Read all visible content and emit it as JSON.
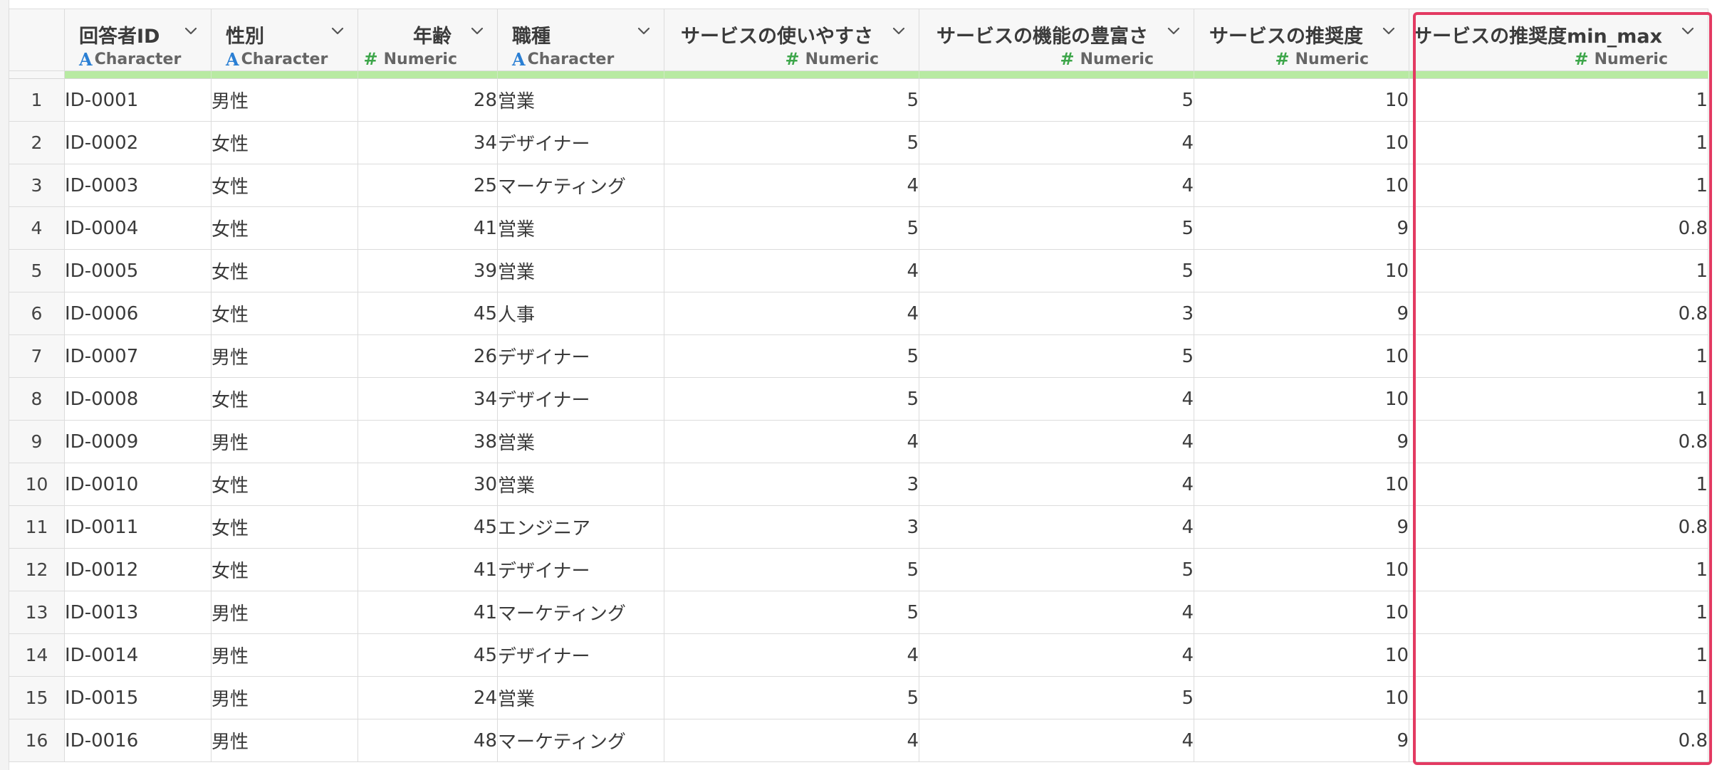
{
  "columns": [
    {
      "name": "回答者ID",
      "type": "Character",
      "align": "left"
    },
    {
      "name": "性別",
      "type": "Character",
      "align": "left"
    },
    {
      "name": "年齢",
      "type": "Numeric",
      "align": "right"
    },
    {
      "name": "職種",
      "type": "Character",
      "align": "left"
    },
    {
      "name": "サービスの使いやすさ",
      "type": "Numeric",
      "align": "right"
    },
    {
      "name": "サービスの機能の豊富さ",
      "type": "Numeric",
      "align": "right"
    },
    {
      "name": "サービスの推奨度",
      "type": "Numeric",
      "align": "right"
    },
    {
      "name": "サービスの推奨度min_max",
      "type": "Numeric",
      "align": "right"
    }
  ],
  "type_icons": {
    "Character": "A",
    "Numeric": "#"
  },
  "rows": [
    {
      "index": "1",
      "cells": [
        "ID-0001",
        "男性",
        "28",
        "営業",
        "5",
        "5",
        "10",
        "1"
      ]
    },
    {
      "index": "2",
      "cells": [
        "ID-0002",
        "女性",
        "34",
        "デザイナー",
        "5",
        "4",
        "10",
        "1"
      ]
    },
    {
      "index": "3",
      "cells": [
        "ID-0003",
        "女性",
        "25",
        "マーケティング",
        "4",
        "4",
        "10",
        "1"
      ]
    },
    {
      "index": "4",
      "cells": [
        "ID-0004",
        "女性",
        "41",
        "営業",
        "5",
        "5",
        "9",
        "0.8"
      ]
    },
    {
      "index": "5",
      "cells": [
        "ID-0005",
        "女性",
        "39",
        "営業",
        "4",
        "5",
        "10",
        "1"
      ]
    },
    {
      "index": "6",
      "cells": [
        "ID-0006",
        "女性",
        "45",
        "人事",
        "4",
        "3",
        "9",
        "0.8"
      ]
    },
    {
      "index": "7",
      "cells": [
        "ID-0007",
        "男性",
        "26",
        "デザイナー",
        "5",
        "5",
        "10",
        "1"
      ]
    },
    {
      "index": "8",
      "cells": [
        "ID-0008",
        "女性",
        "34",
        "デザイナー",
        "5",
        "4",
        "10",
        "1"
      ]
    },
    {
      "index": "9",
      "cells": [
        "ID-0009",
        "男性",
        "38",
        "営業",
        "4",
        "4",
        "9",
        "0.8"
      ]
    },
    {
      "index": "10",
      "cells": [
        "ID-0010",
        "女性",
        "30",
        "営業",
        "3",
        "4",
        "10",
        "1"
      ]
    },
    {
      "index": "11",
      "cells": [
        "ID-0011",
        "女性",
        "45",
        "エンジニア",
        "3",
        "4",
        "9",
        "0.8"
      ]
    },
    {
      "index": "12",
      "cells": [
        "ID-0012",
        "女性",
        "41",
        "デザイナー",
        "5",
        "5",
        "10",
        "1"
      ]
    },
    {
      "index": "13",
      "cells": [
        "ID-0013",
        "男性",
        "41",
        "マーケティング",
        "5",
        "4",
        "10",
        "1"
      ]
    },
    {
      "index": "14",
      "cells": [
        "ID-0014",
        "男性",
        "45",
        "デザイナー",
        "4",
        "4",
        "10",
        "1"
      ]
    },
    {
      "index": "15",
      "cells": [
        "ID-0015",
        "男性",
        "24",
        "営業",
        "5",
        "5",
        "10",
        "1"
      ]
    },
    {
      "index": "16",
      "cells": [
        "ID-0016",
        "男性",
        "48",
        "マーケティング",
        "4",
        "4",
        "9",
        "0.8"
      ]
    }
  ],
  "highlighted_column": "サービスの推奨度min_max",
  "colors": {
    "highlight_border": "#e33a62",
    "header_accent": "#b8eaa2",
    "character_icon": "#2a7fd4",
    "numeric_icon": "#3da64a"
  }
}
